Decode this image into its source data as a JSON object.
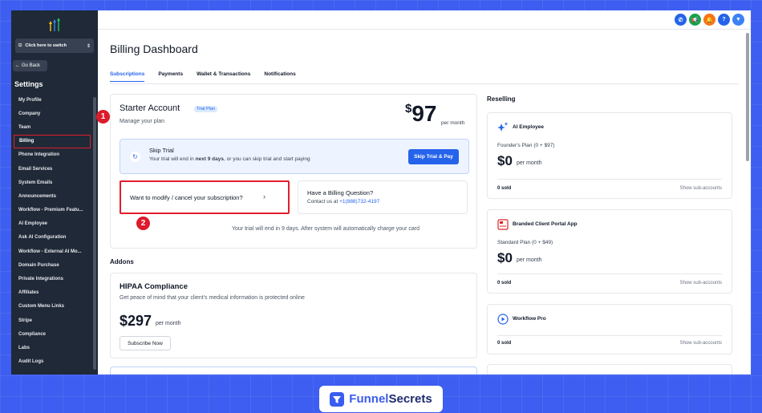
{
  "sidebar": {
    "switcher_label": "Click here to switch",
    "go_back_label": "Go Back",
    "settings_title": "Settings",
    "items": [
      {
        "label": "My Profile"
      },
      {
        "label": "Company"
      },
      {
        "label": "Team"
      },
      {
        "label": "Billing"
      },
      {
        "label": "Phone Integration"
      },
      {
        "label": "Email Services"
      },
      {
        "label": "System Emails"
      },
      {
        "label": "Announcements"
      },
      {
        "label": "Workflow - Premium Featu..."
      },
      {
        "label": "AI Employee"
      },
      {
        "label": "Ask AI Configuration"
      },
      {
        "label": "Workflow - External AI Mo..."
      },
      {
        "label": "Domain Purchase"
      },
      {
        "label": "Private Integrations"
      },
      {
        "label": "Affiliates"
      },
      {
        "label": "Custom Menu Links"
      },
      {
        "label": "Stripe"
      },
      {
        "label": "Compliance"
      },
      {
        "label": "Labs"
      },
      {
        "label": "Audit Logs"
      }
    ]
  },
  "topbar": {
    "icons": [
      "phone-icon",
      "megaphone-icon",
      "bell-icon",
      "help-icon",
      "funnel-icon"
    ],
    "help_glyph": "?"
  },
  "page": {
    "title": "Billing Dashboard",
    "tabs": [
      "Subscriptions",
      "Payments",
      "Wallet & Transactions",
      "Notifications"
    ]
  },
  "starter": {
    "title": "Starter Account",
    "badge": "Trial Plan",
    "subtitle": "Manage your plan",
    "currency": "$",
    "price": "97",
    "per": "per month",
    "trial_title": "Skip Trial",
    "trial_text_pre": "Your trial will end in ",
    "trial_text_bold": "next 9 days",
    "trial_text_post": ", or you can skip trial and start paying",
    "skip_button": "Skip Trial & Pay",
    "modify_text": "Want to modify / cancel your subscription?",
    "question_title": "Have a Billing Question?",
    "contact_label": "Contact us at",
    "contact_phone": "+1(888)732-4197",
    "trial_footer": "Your trial will end in 9 days. After system will automatically charge your card"
  },
  "markers": [
    "1",
    "2"
  ],
  "addons": {
    "title": "Addons",
    "hipaa_title": "HIPAA Compliance",
    "hipaa_sub": "Get peace of mind that your client's medical information is protected online",
    "hipaa_price": "$297",
    "hipaa_per": "per month",
    "subscribe_button": "Subscribe Now"
  },
  "reselling": {
    "title": "Reselling",
    "cards": [
      {
        "name": "AI Employee",
        "plan": "Founder's Plan (0 + $97)",
        "price": "$0",
        "per": "per month",
        "sold": "0 sold",
        "show": "Show sub-accounts"
      },
      {
        "name": "Branded Client Portal App",
        "plan": "Standard Plan (0 + $49)",
        "price": "$0",
        "per": "per month",
        "sold": "0 sold",
        "show": "Show sub-accounts"
      },
      {
        "name": "Workflow Pro",
        "sold": "0 sold",
        "show": "Show sub-accounts"
      }
    ]
  },
  "brand": {
    "part1": "Funnel",
    "part2": "Secrets"
  },
  "colors": {
    "accent": "#2563eb",
    "highlight": "#e11d2e",
    "sidebar_bg": "#1f2937",
    "page_bg": "#3d5ef0"
  }
}
